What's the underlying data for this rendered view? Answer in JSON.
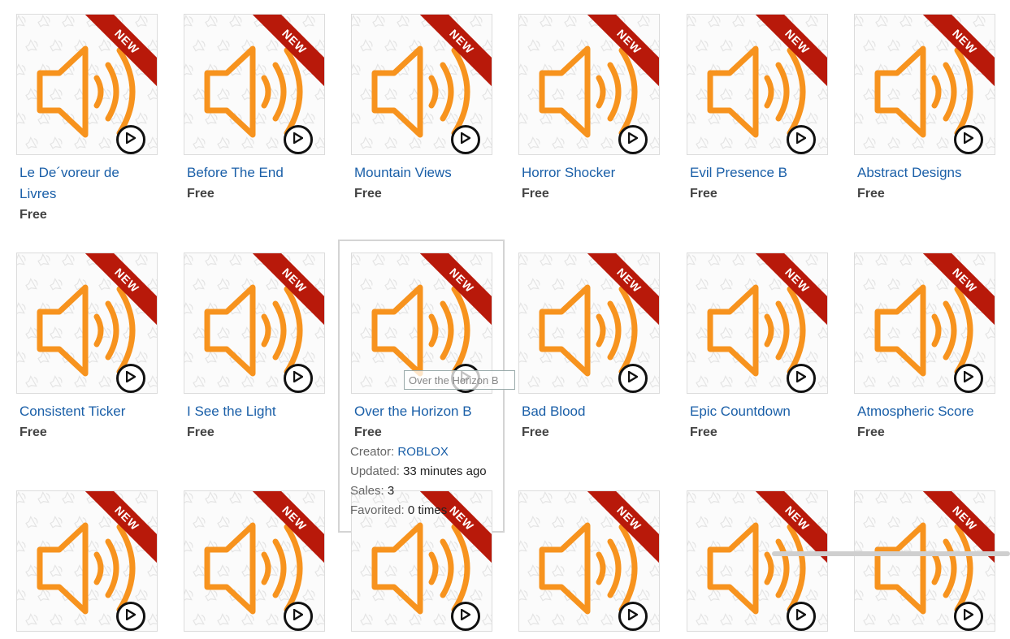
{
  "ribbon_label": "NEW",
  "colors": {
    "accent_orange": "#f7931e",
    "ribbon_red": "#b8190a",
    "link_blue": "#1a5fa8"
  },
  "items": [
    {
      "title": "Le De´voreur de Livres",
      "price": "Free"
    },
    {
      "title": "Before The End",
      "price": "Free"
    },
    {
      "title": "Mountain Views",
      "price": "Free"
    },
    {
      "title": "Horror Shocker",
      "price": "Free"
    },
    {
      "title": "Evil Presence B",
      "price": "Free"
    },
    {
      "title": "Abstract Designs",
      "price": "Free"
    },
    {
      "title": "Consistent Ticker",
      "price": "Free"
    },
    {
      "title": "I See the Light",
      "price": "Free"
    },
    {
      "title": "Over the Horizon B",
      "price": "Free"
    },
    {
      "title": "Bad Blood",
      "price": "Free"
    },
    {
      "title": "Epic Countdown",
      "price": "Free"
    },
    {
      "title": "Atmospheric Score",
      "price": "Free"
    },
    {
      "title": "",
      "price": ""
    },
    {
      "title": "",
      "price": ""
    },
    {
      "title": "",
      "price": ""
    },
    {
      "title": "",
      "price": ""
    },
    {
      "title": "",
      "price": ""
    },
    {
      "title": "",
      "price": ""
    }
  ],
  "hovered": {
    "tooltip": "Over the Horizon B",
    "creator_label": "Creator:",
    "creator_value": "ROBLOX",
    "updated_label": "Updated:",
    "updated_value": "33 minutes ago",
    "sales_label": "Sales:",
    "sales_value": "3",
    "favorited_label": "Favorited:",
    "favorited_value": "0 times"
  }
}
